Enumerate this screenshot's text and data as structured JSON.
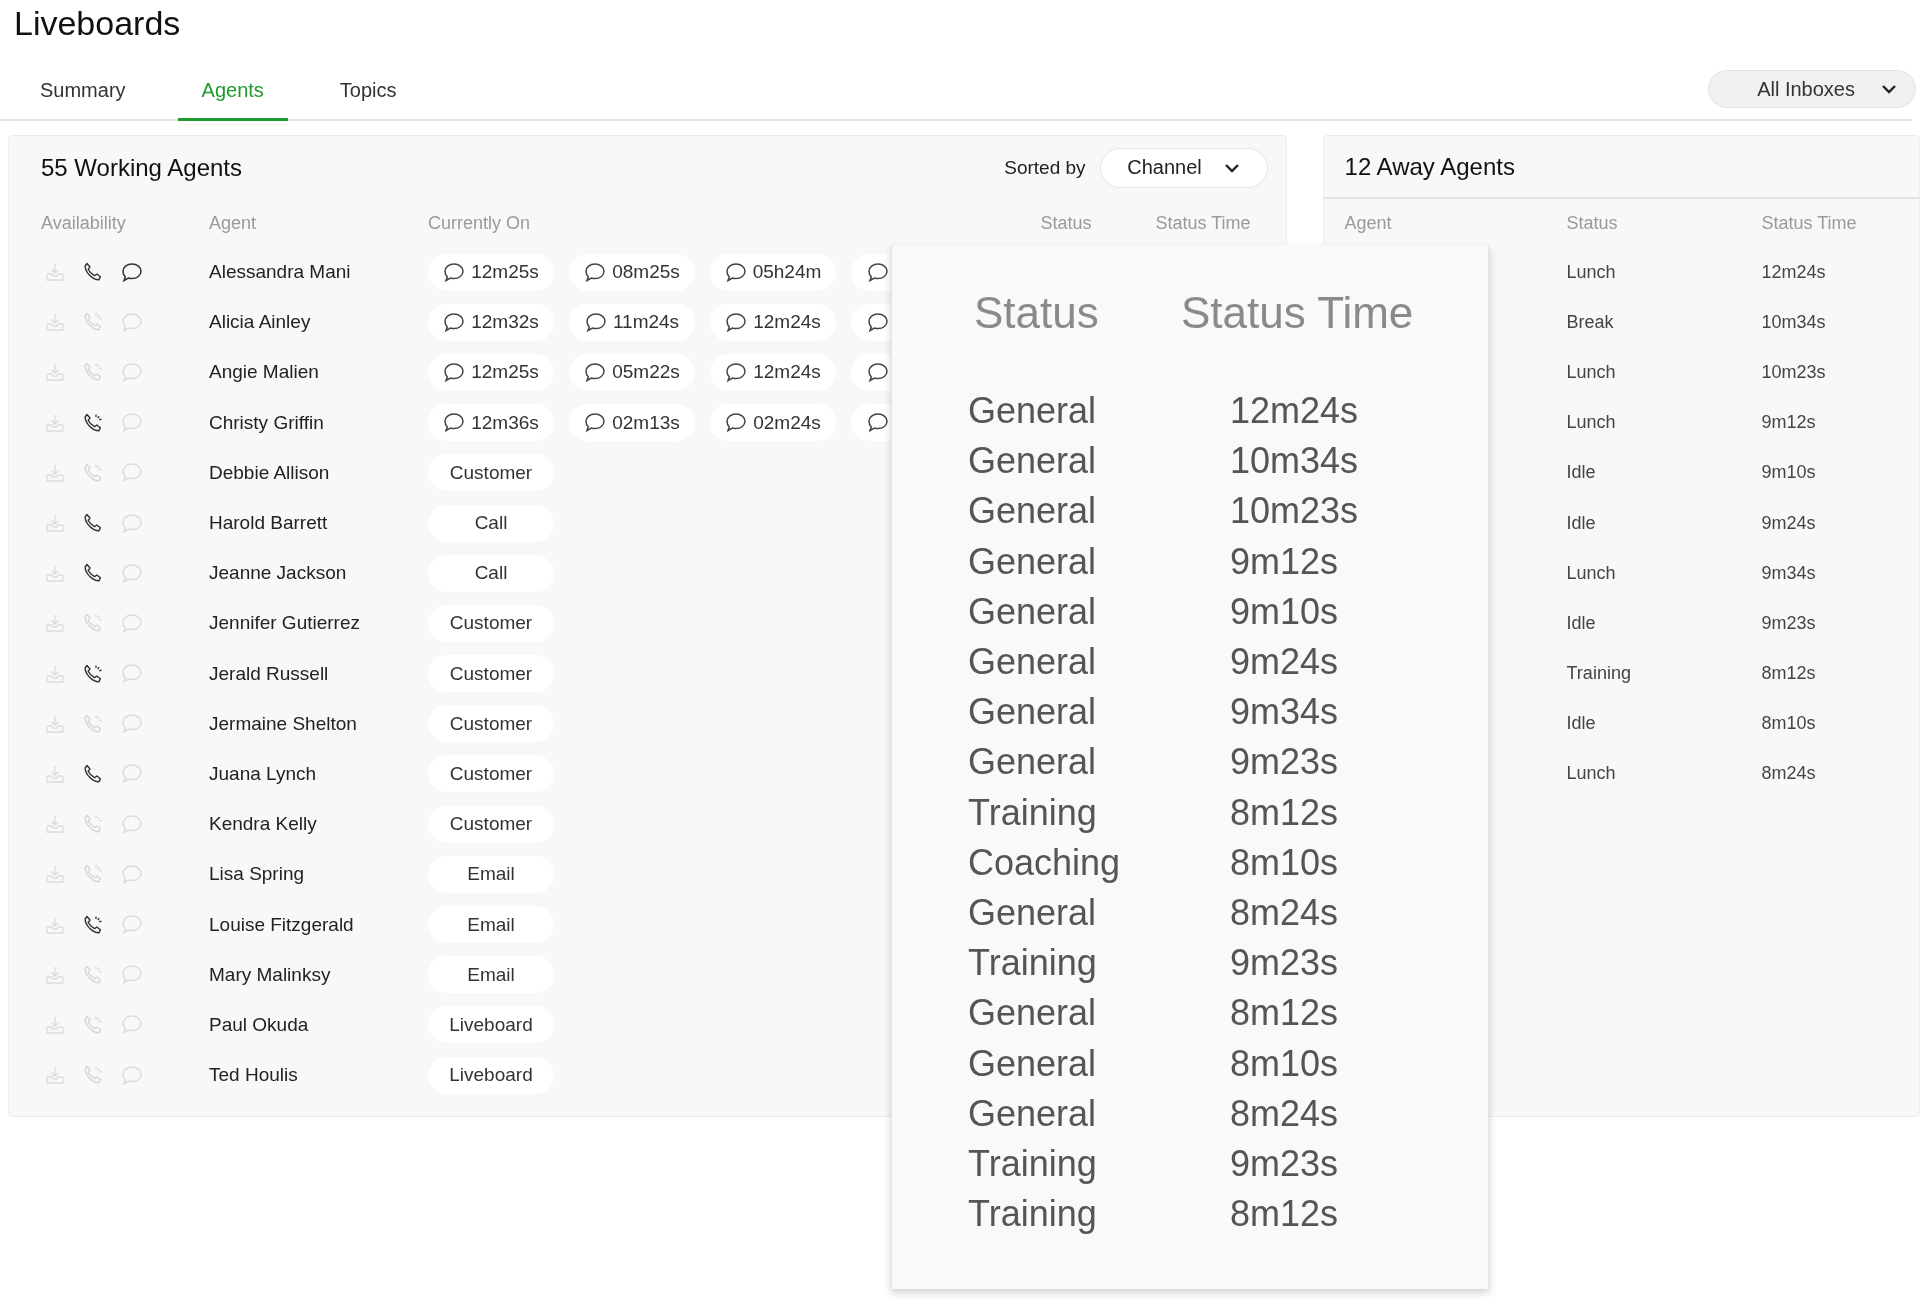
{
  "page_title": "Liveboards",
  "tabs": [
    {
      "label": "Summary",
      "selected": false
    },
    {
      "label": "Agents",
      "selected": true
    },
    {
      "label": "Topics",
      "selected": false
    }
  ],
  "inbox_filter": {
    "value": "All Inboxes"
  },
  "working_agents": {
    "title": "55 Working Agents",
    "sort_label": "Sorted by",
    "sort_value": "Channel",
    "columns": [
      "Availability",
      "Agent",
      "Currently On",
      "Status",
      "Status Time"
    ],
    "rows": [
      {
        "phone_active": true,
        "phone_ringing": false,
        "chat_active": true,
        "agent": "Alessandra Mani",
        "times": [
          "12m25s",
          "08m25s",
          "05h24m"
        ],
        "more": true
      },
      {
        "phone_active": false,
        "phone_ringing": true,
        "chat_active": false,
        "agent": "Alicia Ainley",
        "times": [
          "12m32s",
          "11m24s",
          "12m24s"
        ],
        "more": true
      },
      {
        "phone_active": false,
        "phone_ringing": true,
        "chat_active": false,
        "agent": "Angie Malien",
        "times": [
          "12m25s",
          "05m22s",
          "12m24s"
        ],
        "more": true
      },
      {
        "phone_active": true,
        "phone_ringing": true,
        "chat_active": false,
        "agent": "Christy Griffin",
        "times": [
          "12m36s",
          "02m13s",
          "02m24s"
        ],
        "more": true
      },
      {
        "phone_active": false,
        "phone_ringing": true,
        "chat_active": false,
        "agent": "Debbie Allison",
        "channel": "Customer"
      },
      {
        "phone_active": true,
        "phone_ringing": false,
        "chat_active": false,
        "agent": "Harold Barrett",
        "channel": "Call"
      },
      {
        "phone_active": true,
        "phone_ringing": false,
        "chat_active": false,
        "agent": "Jeanne Jackson",
        "channel": "Call"
      },
      {
        "phone_active": false,
        "phone_ringing": true,
        "chat_active": false,
        "agent": "Jennifer Gutierrez",
        "channel": "Customer"
      },
      {
        "phone_active": true,
        "phone_ringing": true,
        "chat_active": false,
        "agent": "Jerald Russell",
        "channel": "Customer"
      },
      {
        "phone_active": false,
        "phone_ringing": true,
        "chat_active": false,
        "agent": "Jermaine Shelton",
        "channel": "Customer"
      },
      {
        "phone_active": true,
        "phone_ringing": false,
        "chat_active": false,
        "agent": "Juana Lynch",
        "channel": "Customer"
      },
      {
        "phone_active": false,
        "phone_ringing": true,
        "chat_active": false,
        "agent": "Kendra Kelly",
        "channel": "Customer"
      },
      {
        "phone_active": false,
        "phone_ringing": true,
        "chat_active": false,
        "agent": "Lisa Spring",
        "channel": "Email"
      },
      {
        "phone_active": true,
        "phone_ringing": true,
        "chat_active": false,
        "agent": "Louise Fitzgerald",
        "channel": "Email"
      },
      {
        "phone_active": false,
        "phone_ringing": true,
        "chat_active": false,
        "agent": "Mary Malinksy",
        "channel": "Email"
      },
      {
        "phone_active": false,
        "phone_ringing": true,
        "chat_active": false,
        "agent": "Paul Okuda",
        "channel": "Liveboard"
      },
      {
        "phone_active": false,
        "phone_ringing": true,
        "chat_active": false,
        "agent": "Ted Houlis",
        "channel": "Liveboard"
      }
    ]
  },
  "away_agents": {
    "title": "12 Away Agents",
    "columns": [
      "Agent",
      "Status",
      "Status Time"
    ],
    "rows": [
      {
        "status": "Lunch",
        "time": "12m24s"
      },
      {
        "status": "Break",
        "time": "10m34s"
      },
      {
        "status": "Lunch",
        "time": "10m23s"
      },
      {
        "status": "Lunch",
        "time": "9m12s"
      },
      {
        "status": "Idle",
        "time": "9m10s"
      },
      {
        "status": "Idle",
        "time": "9m24s"
      },
      {
        "status": "Lunch",
        "time": "9m34s"
      },
      {
        "status": "Idle",
        "time": "9m23s"
      },
      {
        "status": "Training",
        "time": "8m12s"
      },
      {
        "status": "Idle",
        "time": "8m10s"
      },
      {
        "status": "Lunch",
        "time": "8m24s"
      }
    ]
  },
  "status_zoom": {
    "columns": [
      "Status",
      "Status Time"
    ],
    "rows": [
      {
        "status": "General",
        "time": "12m24s"
      },
      {
        "status": "General",
        "time": "10m34s"
      },
      {
        "status": "General",
        "time": "10m23s"
      },
      {
        "status": "General",
        "time": "9m12s"
      },
      {
        "status": "General",
        "time": "9m10s"
      },
      {
        "status": "General",
        "time": "9m24s"
      },
      {
        "status": "General",
        "time": "9m34s"
      },
      {
        "status": "General",
        "time": "9m23s"
      },
      {
        "status": "Training",
        "time": "8m12s"
      },
      {
        "status": "Coaching",
        "time": "8m10s"
      },
      {
        "status": "General",
        "time": "8m24s"
      },
      {
        "status": "Training",
        "time": "9m23s"
      },
      {
        "status": "General",
        "time": "8m12s"
      },
      {
        "status": "General",
        "time": "8m10s"
      },
      {
        "status": "General",
        "time": "8m24s"
      },
      {
        "status": "Training",
        "time": "9m23s"
      },
      {
        "status": "Training",
        "time": "8m12s"
      }
    ]
  }
}
